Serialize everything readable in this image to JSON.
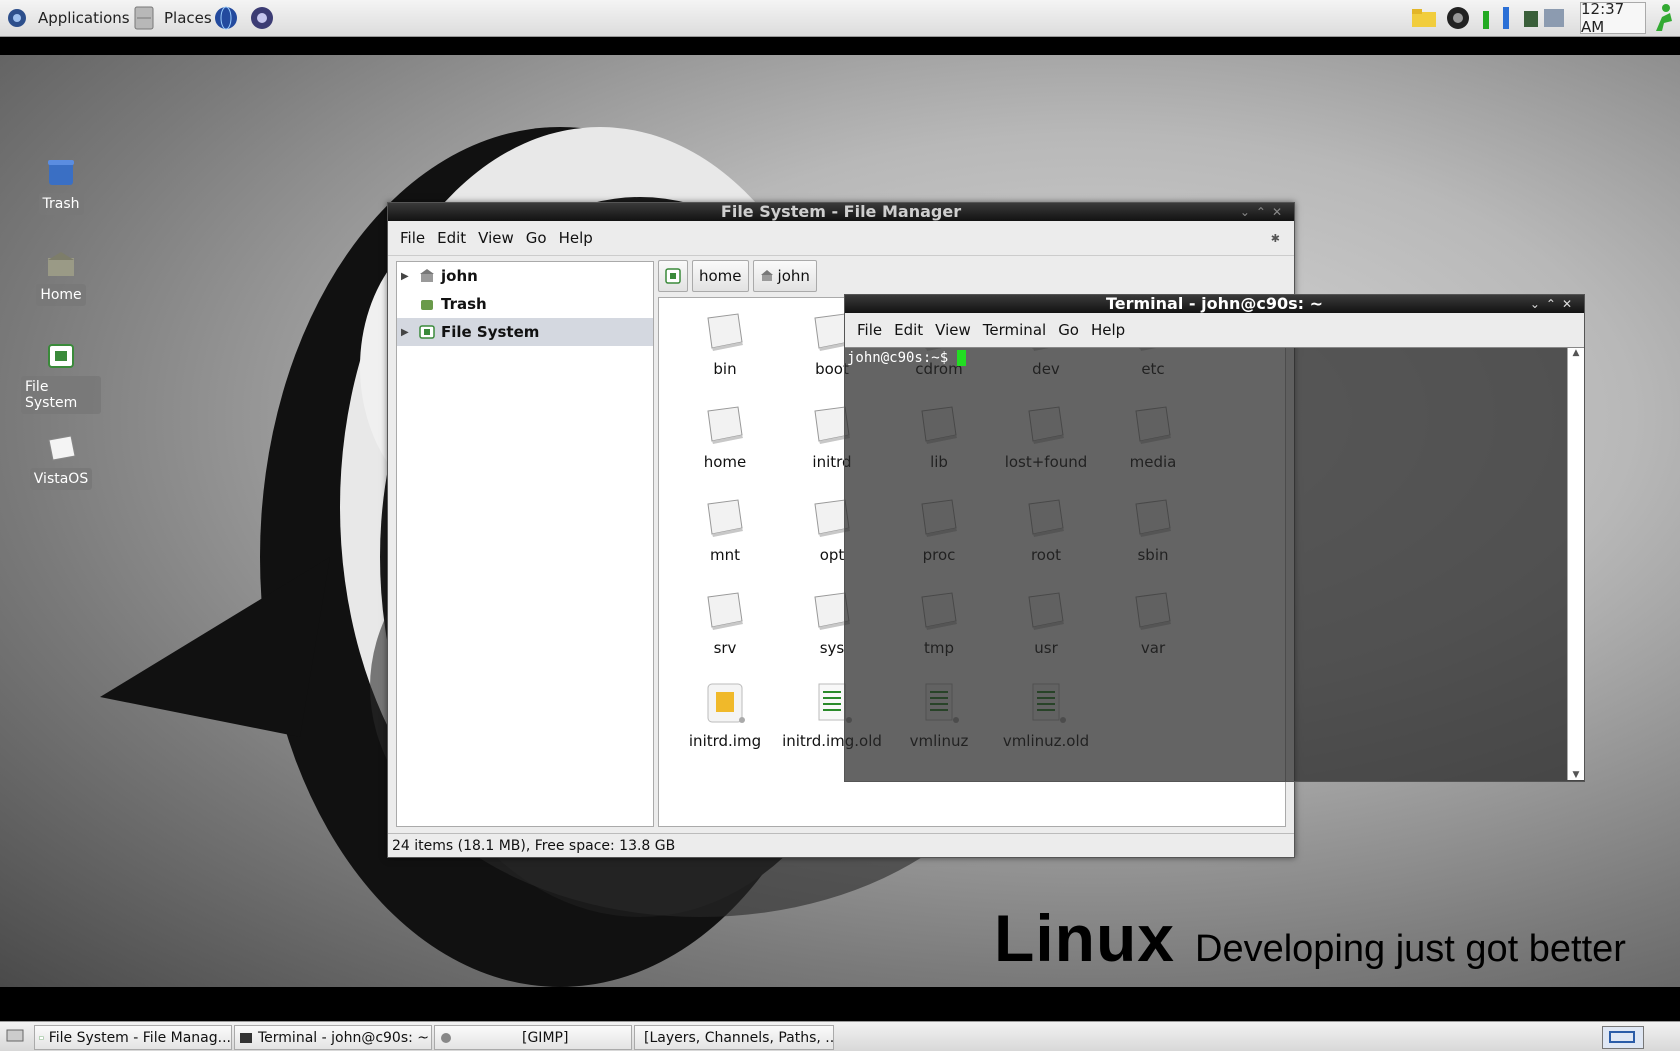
{
  "top_panel": {
    "applications_label": "Applications",
    "places_label": "Places",
    "clock": "12:37 AM"
  },
  "desktop": {
    "icons": [
      {
        "label": "Trash"
      },
      {
        "label": "Home"
      },
      {
        "label": "File System"
      },
      {
        "label": "VistaOS"
      }
    ],
    "tagline_big": "Linux",
    "tagline_small": "Developing just got better"
  },
  "file_manager": {
    "title": "File System - File Manager",
    "menu": [
      "File",
      "Edit",
      "View",
      "Go",
      "Help"
    ],
    "sidebar": [
      {
        "label": "john"
      },
      {
        "label": "Trash"
      },
      {
        "label": "File System"
      }
    ],
    "path": [
      "home",
      "john"
    ],
    "files": [
      "bin",
      "boot",
      "cdrom",
      "dev",
      "etc",
      "home",
      "initrd",
      "lib",
      "lost+found",
      "media",
      "mnt",
      "opt",
      "proc",
      "root",
      "sbin",
      "srv",
      "sys",
      "tmp",
      "usr",
      "var",
      "initrd.img",
      "initrd.img.old",
      "vmlinuz",
      "vmlinuz.old"
    ],
    "status": "24 items (18.1 MB), Free space: 13.8 GB"
  },
  "terminal": {
    "title": "Terminal - john@c90s: ~",
    "menu": [
      "File",
      "Edit",
      "View",
      "Terminal",
      "Go",
      "Help"
    ],
    "prompt": "john@c90s:~$ "
  },
  "taskbar": {
    "tasks": [
      {
        "label": "File System - File Manag..."
      },
      {
        "label": "Terminal - john@c90s: ~"
      },
      {
        "label": "[GIMP]"
      },
      {
        "label": "[Layers, Channels, Paths, ..."
      }
    ]
  }
}
